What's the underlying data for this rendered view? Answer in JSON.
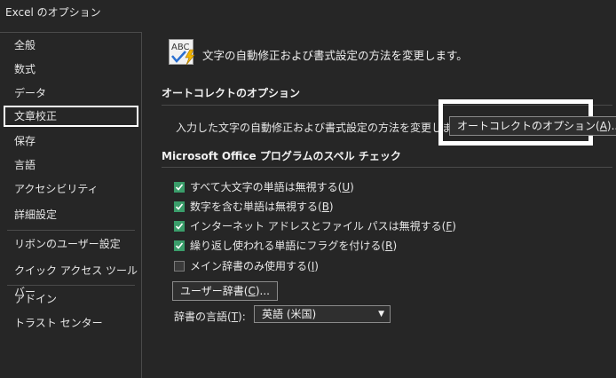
{
  "window": {
    "title": "Excel のオプション"
  },
  "sidebar": {
    "items": [
      {
        "label": "全般"
      },
      {
        "label": "数式"
      },
      {
        "label": "データ"
      },
      {
        "label": "文章校正",
        "selected": true
      },
      {
        "label": "保存"
      },
      {
        "label": "言語"
      },
      {
        "label": "アクセシビリティ"
      },
      {
        "label": "詳細設定"
      },
      {
        "label": "リボンのユーザー設定"
      },
      {
        "label": "クイック アクセス ツール バー"
      },
      {
        "label": "アドイン"
      },
      {
        "label": "トラスト センター"
      }
    ]
  },
  "main": {
    "header_icon": "abc-check-lightning-icon",
    "header_text": "文字の自動修正および書式設定の方法を変更します。",
    "autocorrect": {
      "title": "オートコレクトのオプション",
      "description": "入力した文字の自動修正および書式設定の方法を変更します:",
      "button_prefix": "オートコレクトのオプション(",
      "button_key": "A",
      "button_suffix": ")..."
    },
    "spelling": {
      "title": "Microsoft Office プログラムのスペル チェック",
      "options": [
        {
          "prefix": "すべて大文字の単語は無視する(",
          "key": "U",
          "suffix": ")",
          "checked": true
        },
        {
          "prefix": "数字を含む単語は無視する(",
          "key": "B",
          "suffix": ")",
          "checked": true
        },
        {
          "prefix": "インターネット アドレスとファイル パスは無視する(",
          "key": "F",
          "suffix": ")",
          "checked": true
        },
        {
          "prefix": "繰り返し使われる単語にフラグを付ける(",
          "key": "R",
          "suffix": ")",
          "checked": true
        },
        {
          "prefix": "メイン辞書のみ使用する(",
          "key": "I",
          "suffix": ")",
          "checked": false
        }
      ],
      "dict_button": {
        "prefix": "ユーザー辞書(",
        "key": "C",
        "suffix": ")..."
      },
      "lang_label": {
        "prefix": "辞書の言語(",
        "key": "T",
        "suffix": "):"
      },
      "lang_value": "英語 (米国)"
    }
  },
  "colors": {
    "background": "#262626",
    "checkbox_on": "#3a9d6a",
    "border": "#4a4a4a"
  }
}
